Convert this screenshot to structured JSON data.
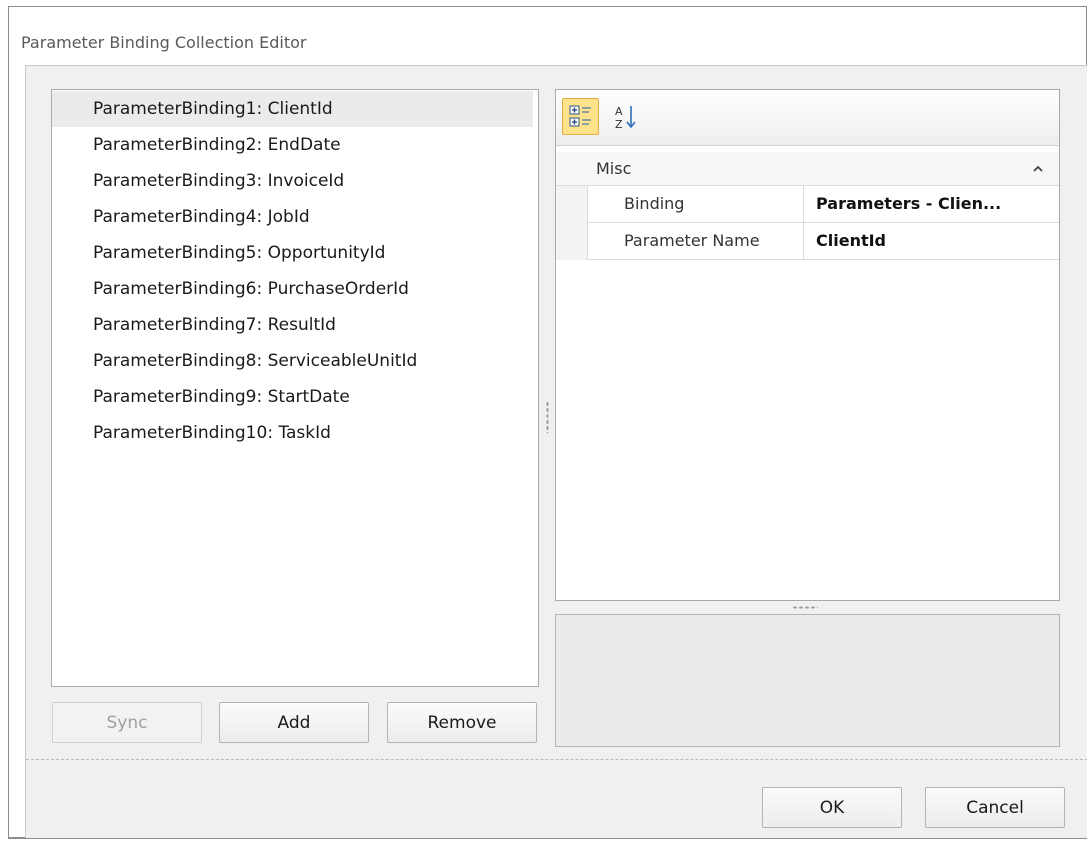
{
  "window": {
    "title": "Parameter Binding Collection Editor"
  },
  "list": {
    "items": [
      "ParameterBinding1: ClientId",
      "ParameterBinding2: EndDate",
      "ParameterBinding3: InvoiceId",
      "ParameterBinding4: JobId",
      "ParameterBinding5: OpportunityId",
      "ParameterBinding6: PurchaseOrderId",
      "ParameterBinding7: ResultId",
      "ParameterBinding8: ServiceableUnitId",
      "ParameterBinding9: StartDate",
      "ParameterBinding10: TaskId"
    ],
    "selected_index": 0
  },
  "list_buttons": {
    "sync": "Sync",
    "add": "Add",
    "remove": "Remove"
  },
  "property_grid": {
    "toolbar": {
      "categorized_icon": "categorized-icon",
      "alphabetical_icon": "sort-az-icon",
      "categorized_active": true
    },
    "category": "Misc",
    "rows": [
      {
        "name": "Binding",
        "value": "Parameters - Clien..."
      },
      {
        "name": "Parameter Name",
        "value": "ClientId"
      }
    ]
  },
  "dialog_buttons": {
    "ok": "OK",
    "cancel": "Cancel"
  },
  "colors": {
    "selected_item": "#ebebeb",
    "toolbar_active": "#ffe28a",
    "client_bg": "#f0f0f0"
  }
}
